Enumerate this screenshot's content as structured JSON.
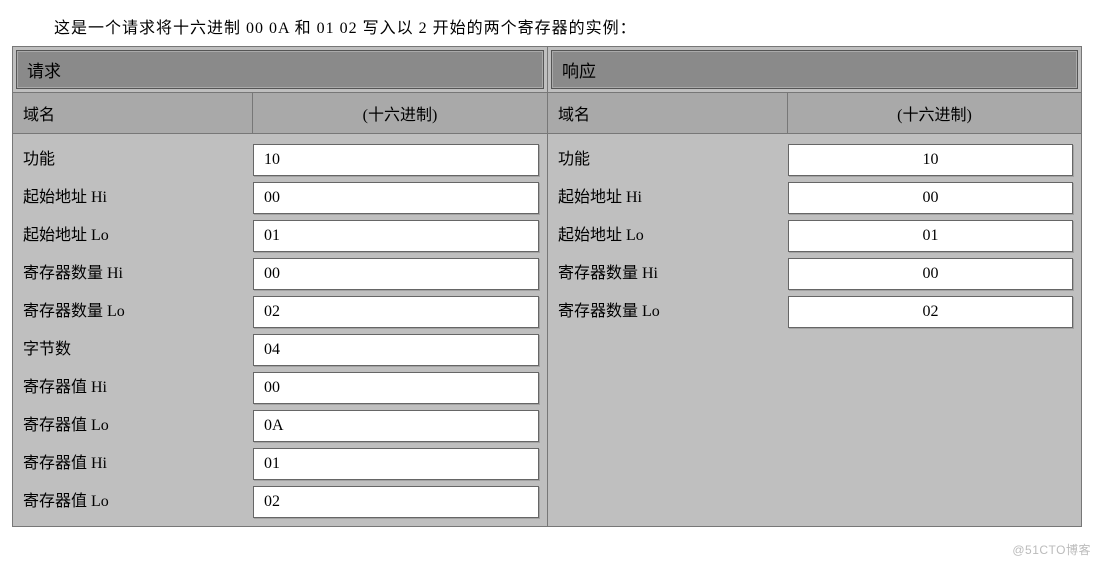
{
  "intro": "这是一个请求将十六进制 00 0A 和 01 02 写入以 2 开始的两个寄存器的实例：",
  "left": {
    "title": "请求",
    "header_field": "域名",
    "header_hex": "(十六进制)",
    "labels": [
      "功能",
      "起始地址 Hi",
      "起始地址 Lo",
      "寄存器数量 Hi",
      "寄存器数量 Lo",
      "字节数",
      "寄存器值 Hi",
      "寄存器值 Lo",
      "寄存器值 Hi",
      "寄存器值 Lo"
    ],
    "values": [
      "10",
      "00",
      "01",
      "00",
      "02",
      "04",
      "00",
      "0A",
      "01",
      "02"
    ]
  },
  "right": {
    "title": "响应",
    "header_field": "域名",
    "header_hex": "(十六进制)",
    "labels": [
      "功能",
      "起始地址 Hi",
      "起始地址 Lo",
      "寄存器数量 Hi",
      "寄存器数量 Lo"
    ],
    "values": [
      "10",
      "00",
      "01",
      "00",
      "02"
    ]
  },
  "watermark": "@51CTO博客"
}
